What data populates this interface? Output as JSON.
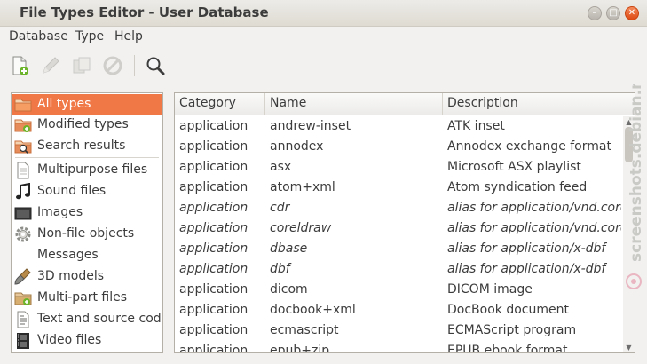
{
  "window": {
    "title": "File Types Editor - User Database"
  },
  "menubar": {
    "items": [
      "Database",
      "Type",
      "Help"
    ]
  },
  "toolbar": {
    "buttons": [
      {
        "icon": "new-file-icon",
        "enabled": true
      },
      {
        "icon": "edit-pencil-icon",
        "enabled": false
      },
      {
        "icon": "copy-icon",
        "enabled": false
      },
      {
        "icon": "delete-icon",
        "enabled": false
      },
      {
        "icon": "search-icon",
        "enabled": true
      }
    ]
  },
  "sidebar": {
    "items": [
      {
        "label": "All types",
        "icon": "folder-icon",
        "selected": true
      },
      {
        "label": "Modified types",
        "icon": "modified-folder-icon"
      },
      {
        "label": "Search results",
        "icon": "search-folder-icon"
      },
      {
        "label": "Multipurpose files",
        "icon": "document-icon"
      },
      {
        "label": "Sound files",
        "icon": "music-note-icon"
      },
      {
        "label": "Images",
        "icon": "image-icon"
      },
      {
        "label": "Non-file objects",
        "icon": "gear-icon"
      },
      {
        "label": "Messages",
        "icon": ""
      },
      {
        "label": "3D models",
        "icon": "paintbrush-icon"
      },
      {
        "label": "Multi-part files",
        "icon": "archive-icon"
      },
      {
        "label": "Text and source code",
        "icon": "text-document-icon"
      },
      {
        "label": "Video files",
        "icon": "film-icon"
      }
    ]
  },
  "table": {
    "columns": [
      "Category",
      "Name",
      "Description"
    ],
    "rows": [
      {
        "category": "application",
        "name": "andrew-inset",
        "description": "ATK inset",
        "alias": false
      },
      {
        "category": "application",
        "name": "annodex",
        "description": "Annodex exchange format",
        "alias": false
      },
      {
        "category": "application",
        "name": "asx",
        "description": "Microsoft ASX playlist",
        "alias": false
      },
      {
        "category": "application",
        "name": "atom+xml",
        "description": "Atom syndication feed",
        "alias": false
      },
      {
        "category": "application",
        "name": "cdr",
        "description": "alias for application/vnd.corel-",
        "alias": true
      },
      {
        "category": "application",
        "name": "coreldraw",
        "description": "alias for application/vnd.corel-",
        "alias": true
      },
      {
        "category": "application",
        "name": "dbase",
        "description": "alias for application/x-dbf",
        "alias": true
      },
      {
        "category": "application",
        "name": "dbf",
        "description": "alias for application/x-dbf",
        "alias": true
      },
      {
        "category": "application",
        "name": "dicom",
        "description": "DICOM image",
        "alias": false
      },
      {
        "category": "application",
        "name": "docbook+xml",
        "description": "DocBook document",
        "alias": false
      },
      {
        "category": "application",
        "name": "ecmascript",
        "description": "ECMAScript program",
        "alias": false
      },
      {
        "category": "application",
        "name": "epub+zip",
        "description": "EPUB ebook format",
        "alias": false
      }
    ]
  },
  "watermark": {
    "text": "screenshots.debian.net"
  },
  "colors": {
    "selection": "#f07746",
    "close_button": "#e25a22"
  }
}
